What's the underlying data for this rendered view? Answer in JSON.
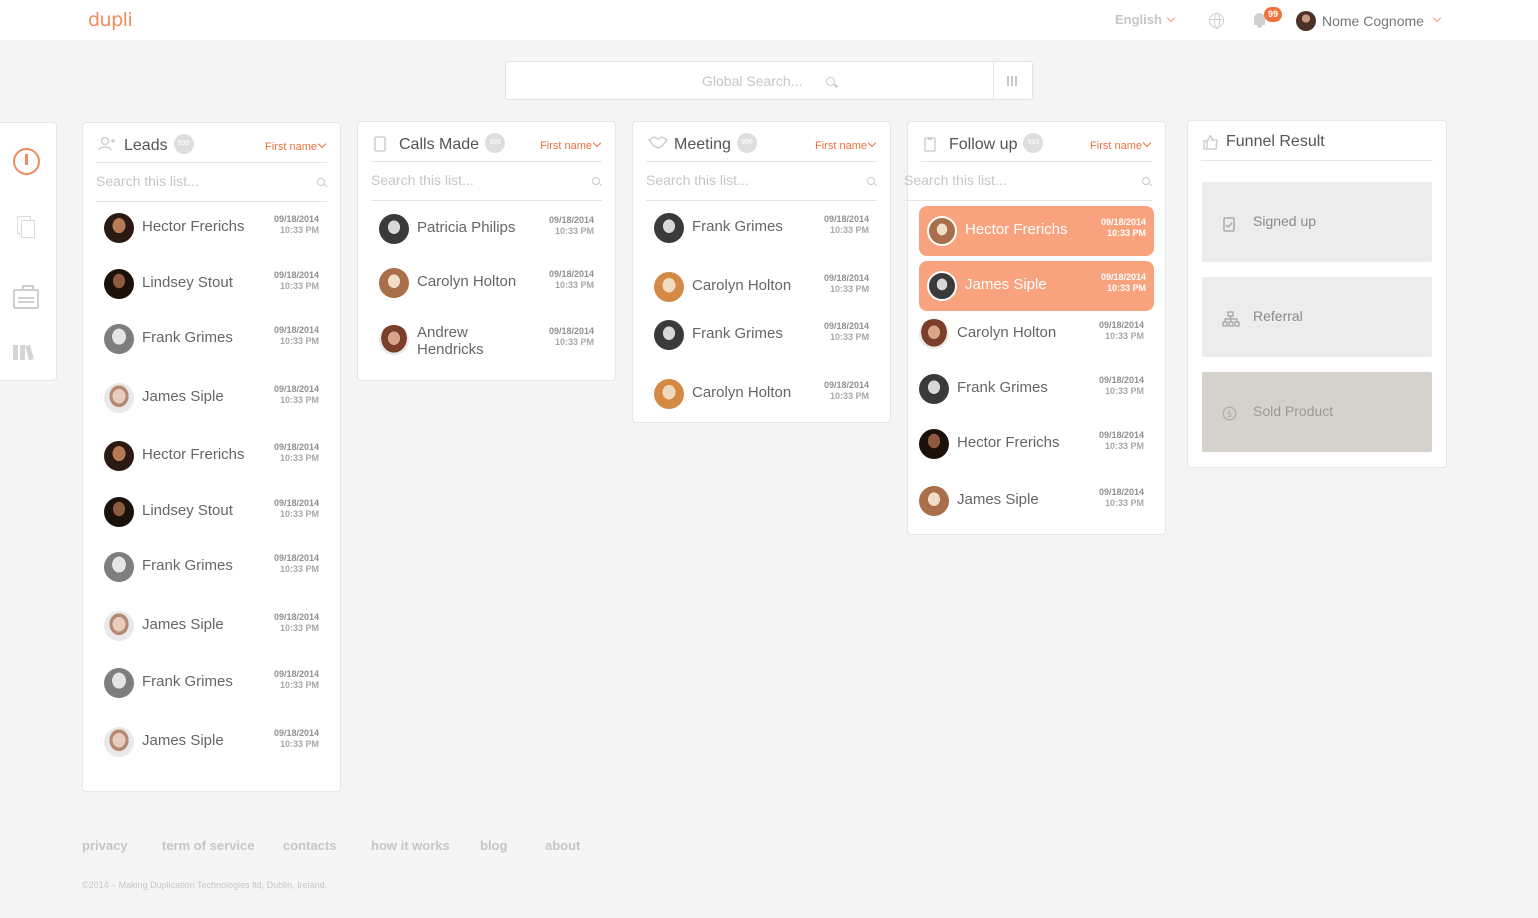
{
  "header": {
    "logo": "dupli",
    "language": "English",
    "notifications_count": "99",
    "user_name": "Nome Cognome"
  },
  "search": {
    "placeholder": "Global Search..."
  },
  "columns": [
    {
      "title": "Leads",
      "count": "999",
      "sort": "First name",
      "search_placeholder": "Search this list...",
      "rows": [
        {
          "name": "Hector Frerichs",
          "date": "09/18/2014",
          "time": "10:33 PM"
        },
        {
          "name": "Lindsey Stout",
          "date": "09/18/2014",
          "time": "10:33 PM"
        },
        {
          "name": "Frank Grimes",
          "date": "09/18/2014",
          "time": "10:33 PM"
        },
        {
          "name": "James Siple",
          "date": "09/18/2014",
          "time": "10:33 PM"
        },
        {
          "name": "Hector Frerichs",
          "date": "09/18/2014",
          "time": "10:33 PM"
        },
        {
          "name": "Lindsey Stout",
          "date": "09/18/2014",
          "time": "10:33 PM"
        },
        {
          "name": "Frank Grimes",
          "date": "09/18/2014",
          "time": "10:33 PM"
        },
        {
          "name": "James Siple",
          "date": "09/18/2014",
          "time": "10:33 PM"
        },
        {
          "name": "Frank Grimes",
          "date": "09/18/2014",
          "time": "10:33 PM"
        },
        {
          "name": "James Siple",
          "date": "09/18/2014",
          "time": "10:33 PM"
        }
      ]
    },
    {
      "title": "Calls Made",
      "count": "999",
      "sort": "First name",
      "search_placeholder": "Search this list...",
      "rows": [
        {
          "name": "Patricia Philips",
          "date": "09/18/2014",
          "time": "10:33 PM"
        },
        {
          "name": "Carolyn Holton",
          "date": "09/18/2014",
          "time": "10:33 PM"
        },
        {
          "name": "Andrew Hendricks",
          "date": "09/18/2014",
          "time": "10:33 PM"
        }
      ]
    },
    {
      "title": "Meeting",
      "count": "999",
      "sort": "First name",
      "search_placeholder": "Search this list...",
      "rows": [
        {
          "name": "Frank Grimes",
          "date": "09/18/2014",
          "time": "10:33 PM"
        },
        {
          "name": "Carolyn Holton",
          "date": "09/18/2014",
          "time": "10:33 PM"
        },
        {
          "name": "Frank Grimes",
          "date": "09/18/2014",
          "time": "10:33 PM"
        },
        {
          "name": "Carolyn Holton",
          "date": "09/18/2014",
          "time": "10:33 PM"
        }
      ]
    },
    {
      "title": "Follow up",
      "count": "999",
      "sort": "First name",
      "search_placeholder": "Search this list...",
      "rows": [
        {
          "name": "Hector Frerichs",
          "date": "09/18/2014",
          "time": "10:33 PM"
        },
        {
          "name": "James Siple",
          "date": "09/18/2014",
          "time": "10:33 PM"
        },
        {
          "name": "Carolyn Holton",
          "date": "09/18/2014",
          "time": "10:33 PM"
        },
        {
          "name": "Frank Grimes",
          "date": "09/18/2014",
          "time": "10:33 PM"
        },
        {
          "name": "Hector Frerichs",
          "date": "09/18/2014",
          "time": "10:33 PM"
        },
        {
          "name": "James Siple",
          "date": "09/18/2014",
          "time": "10:33 PM"
        }
      ]
    }
  ],
  "funnel": {
    "title": "Funnel Result",
    "items": [
      {
        "label": "Signed up",
        "icon": "clipboard-check-icon"
      },
      {
        "label": "Referral",
        "icon": "org-chart-icon"
      },
      {
        "label": "Sold Product",
        "icon": "dollar-circle-icon"
      }
    ]
  },
  "footer": {
    "links": [
      "privacy",
      "term of service",
      "contacts",
      "how it works",
      "blog",
      "about"
    ],
    "copyright": "©2014 – Making Duplication Technologies ltd, Dublin, Ireland."
  },
  "colors": {
    "accent": "#f0703e",
    "active_row": "#f9a27e",
    "background": "#f5f5f5"
  }
}
